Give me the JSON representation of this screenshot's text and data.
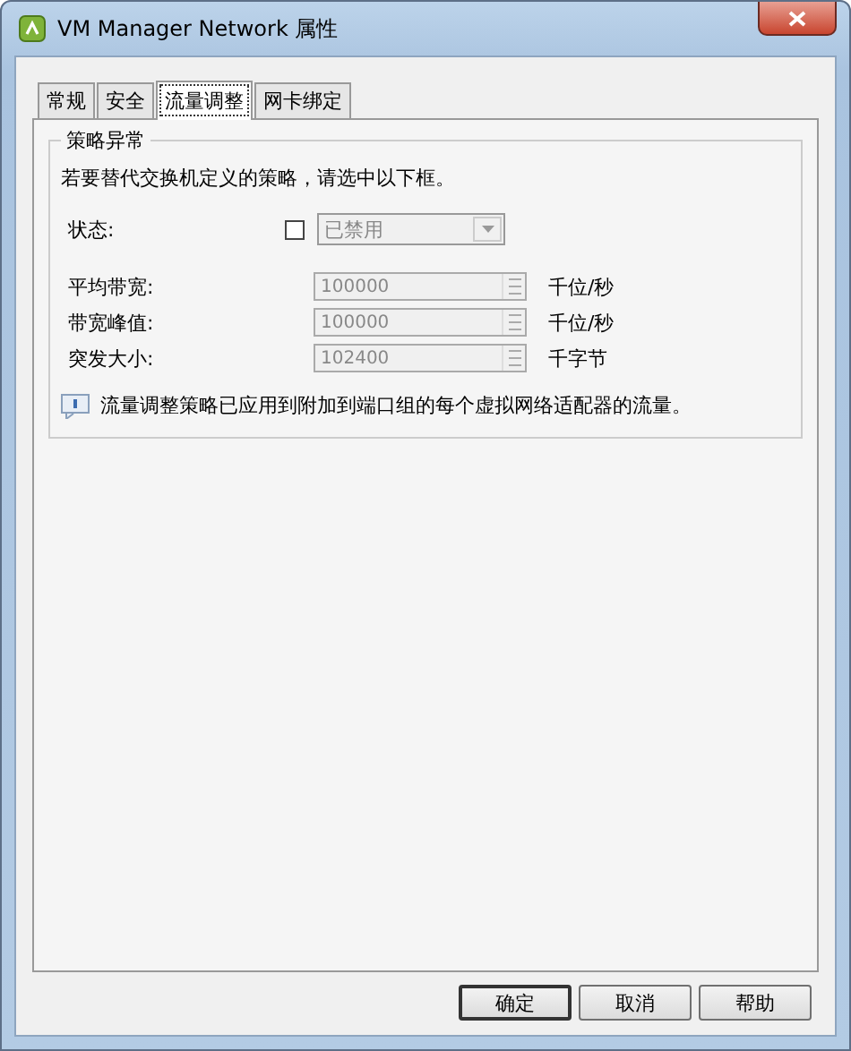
{
  "window": {
    "title": "VM Manager Network 属性"
  },
  "tabs": [
    {
      "label": "常规",
      "selected": false
    },
    {
      "label": "安全",
      "selected": false
    },
    {
      "label": "流量调整",
      "selected": true
    },
    {
      "label": "网卡绑定",
      "selected": false
    }
  ],
  "group": {
    "title": "策略异常",
    "description": "若要替代交换机定义的策略，请选中以下框。",
    "status": {
      "label": "状态:",
      "checked": false,
      "value": "已禁用",
      "disabled": true
    },
    "fields": [
      {
        "label": "平均带宽:",
        "value": "100000",
        "unit": "千位/秒",
        "disabled": true
      },
      {
        "label": "带宽峰值:",
        "value": "100000",
        "unit": "千位/秒",
        "disabled": true
      },
      {
        "label": "突发大小:",
        "value": "102400",
        "unit": "千字节",
        "disabled": true
      }
    ],
    "info": "流量调整策略已应用到附加到端口组的每个虚拟网络适配器的流量。"
  },
  "buttons": [
    {
      "label": "确定",
      "default": true
    },
    {
      "label": "取消",
      "default": false
    },
    {
      "label": "帮助",
      "default": false
    }
  ]
}
